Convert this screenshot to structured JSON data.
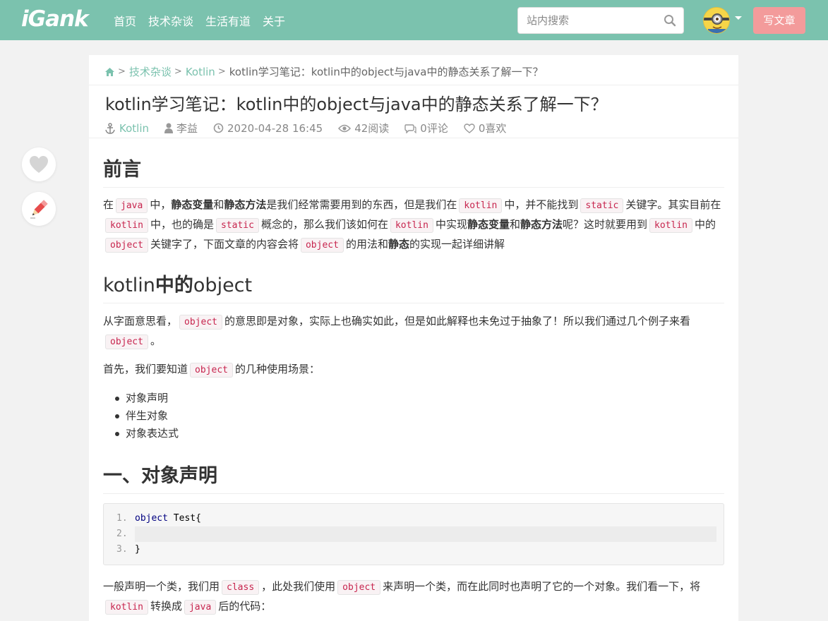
{
  "header": {
    "logo": "iGank",
    "nav": [
      "首页",
      "技术杂谈",
      "生活有道",
      "关于"
    ],
    "search_placeholder": "站内搜索",
    "write_label": "写文章"
  },
  "breadcrumb": {
    "items": [
      "技术杂谈",
      "Kotlin",
      "kotlin学习笔记：kotlin中的object与java中的静态关系了解一下？"
    ]
  },
  "article": {
    "title": "kotlin学习笔记：kotlin中的object与java中的静态关系了解一下？",
    "meta": {
      "category": "Kotlin",
      "author": "李益",
      "date": "2020-04-28 16:45",
      "reads": "42阅读",
      "comments": "0评论",
      "likes": "0喜欢"
    },
    "sections": {
      "preface_title": "前言",
      "object_title_a": "kotlin",
      "object_title_b": "中的",
      "object_title_c": "object",
      "decl_title": "一、对象声明"
    },
    "preface": {
      "t1": "在",
      "c1": "java",
      "t2": "中，",
      "b1": "静态变量",
      "t3": "和",
      "b2": "静态方法",
      "t4": "是我们经常需要用到的东西，但是我们在",
      "c2": "kotlin",
      "t5": "中，并不能找到",
      "c3": "static",
      "t6": "关键字。其实目前在",
      "c4": "kotlin",
      "t7": "中，也的确是",
      "c5": "static",
      "t8": "概念的，那么我们该如何在",
      "c6": "kotlin",
      "t9": "中实现",
      "b3": "静态变量",
      "t10": "和",
      "b4": "静态方法",
      "t11": "呢？这时就要用到",
      "c7": "kotlin",
      "t12": "中的",
      "c8": "object",
      "t13": "关键字了，下面文章的内容会将",
      "c9": "object",
      "t14": "的用法和",
      "b5": "静态",
      "t15": "的实现一起详细讲解"
    },
    "object_p1": {
      "t1": "从字面意思看，",
      "c1": "object",
      "t2": "的意思即是对象，实际上也确实如此，但是如此解释也未免过于抽象了！所以我们通过几个例子来看",
      "c2": "object",
      "t3": "。"
    },
    "object_p2": {
      "t1": "首先，我们要知道",
      "c1": "object",
      "t2": "的几种使用场景："
    },
    "scenarios": [
      "对象声明",
      "伴生对象",
      "对象表达式"
    ],
    "code": {
      "line1_num": "1.",
      "line1_kw": "object",
      "line1_rest": " Test{",
      "line2_num": "2.",
      "line3_num": "3.",
      "line3_text": "}"
    },
    "decl_p1": {
      "t1": "一般声明一个类，我们用",
      "c1": "class",
      "t2": "，此处我们使用",
      "c2": "object",
      "t3": "来声明一个类，而在此同时也声明了它的一个对象。我们看一下，将",
      "c3": "kotlin",
      "t4": "转换成",
      "c4": "java",
      "t5": "后的代码："
    }
  },
  "colors": {
    "brand": "#7bc2ae",
    "write_button": "#f39b9b",
    "inline_code": "#c7254e"
  }
}
